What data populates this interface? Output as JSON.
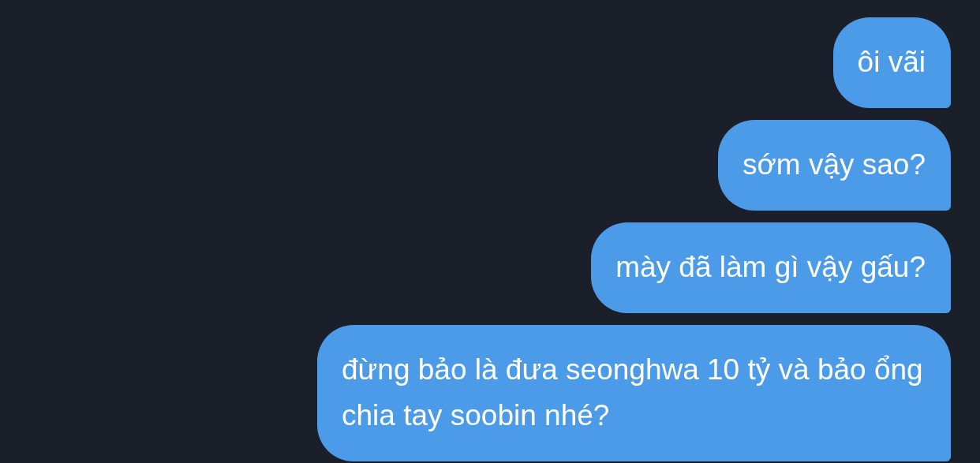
{
  "messages": [
    {
      "text": "ôi vãi"
    },
    {
      "text": "sớm vậy sao?"
    },
    {
      "text": "mày đã làm gì vậy gấu?"
    },
    {
      "text": "đừng bảo là đưa seonghwa 10 tỷ và bảo ổng chia tay soobin nhé?"
    }
  ]
}
